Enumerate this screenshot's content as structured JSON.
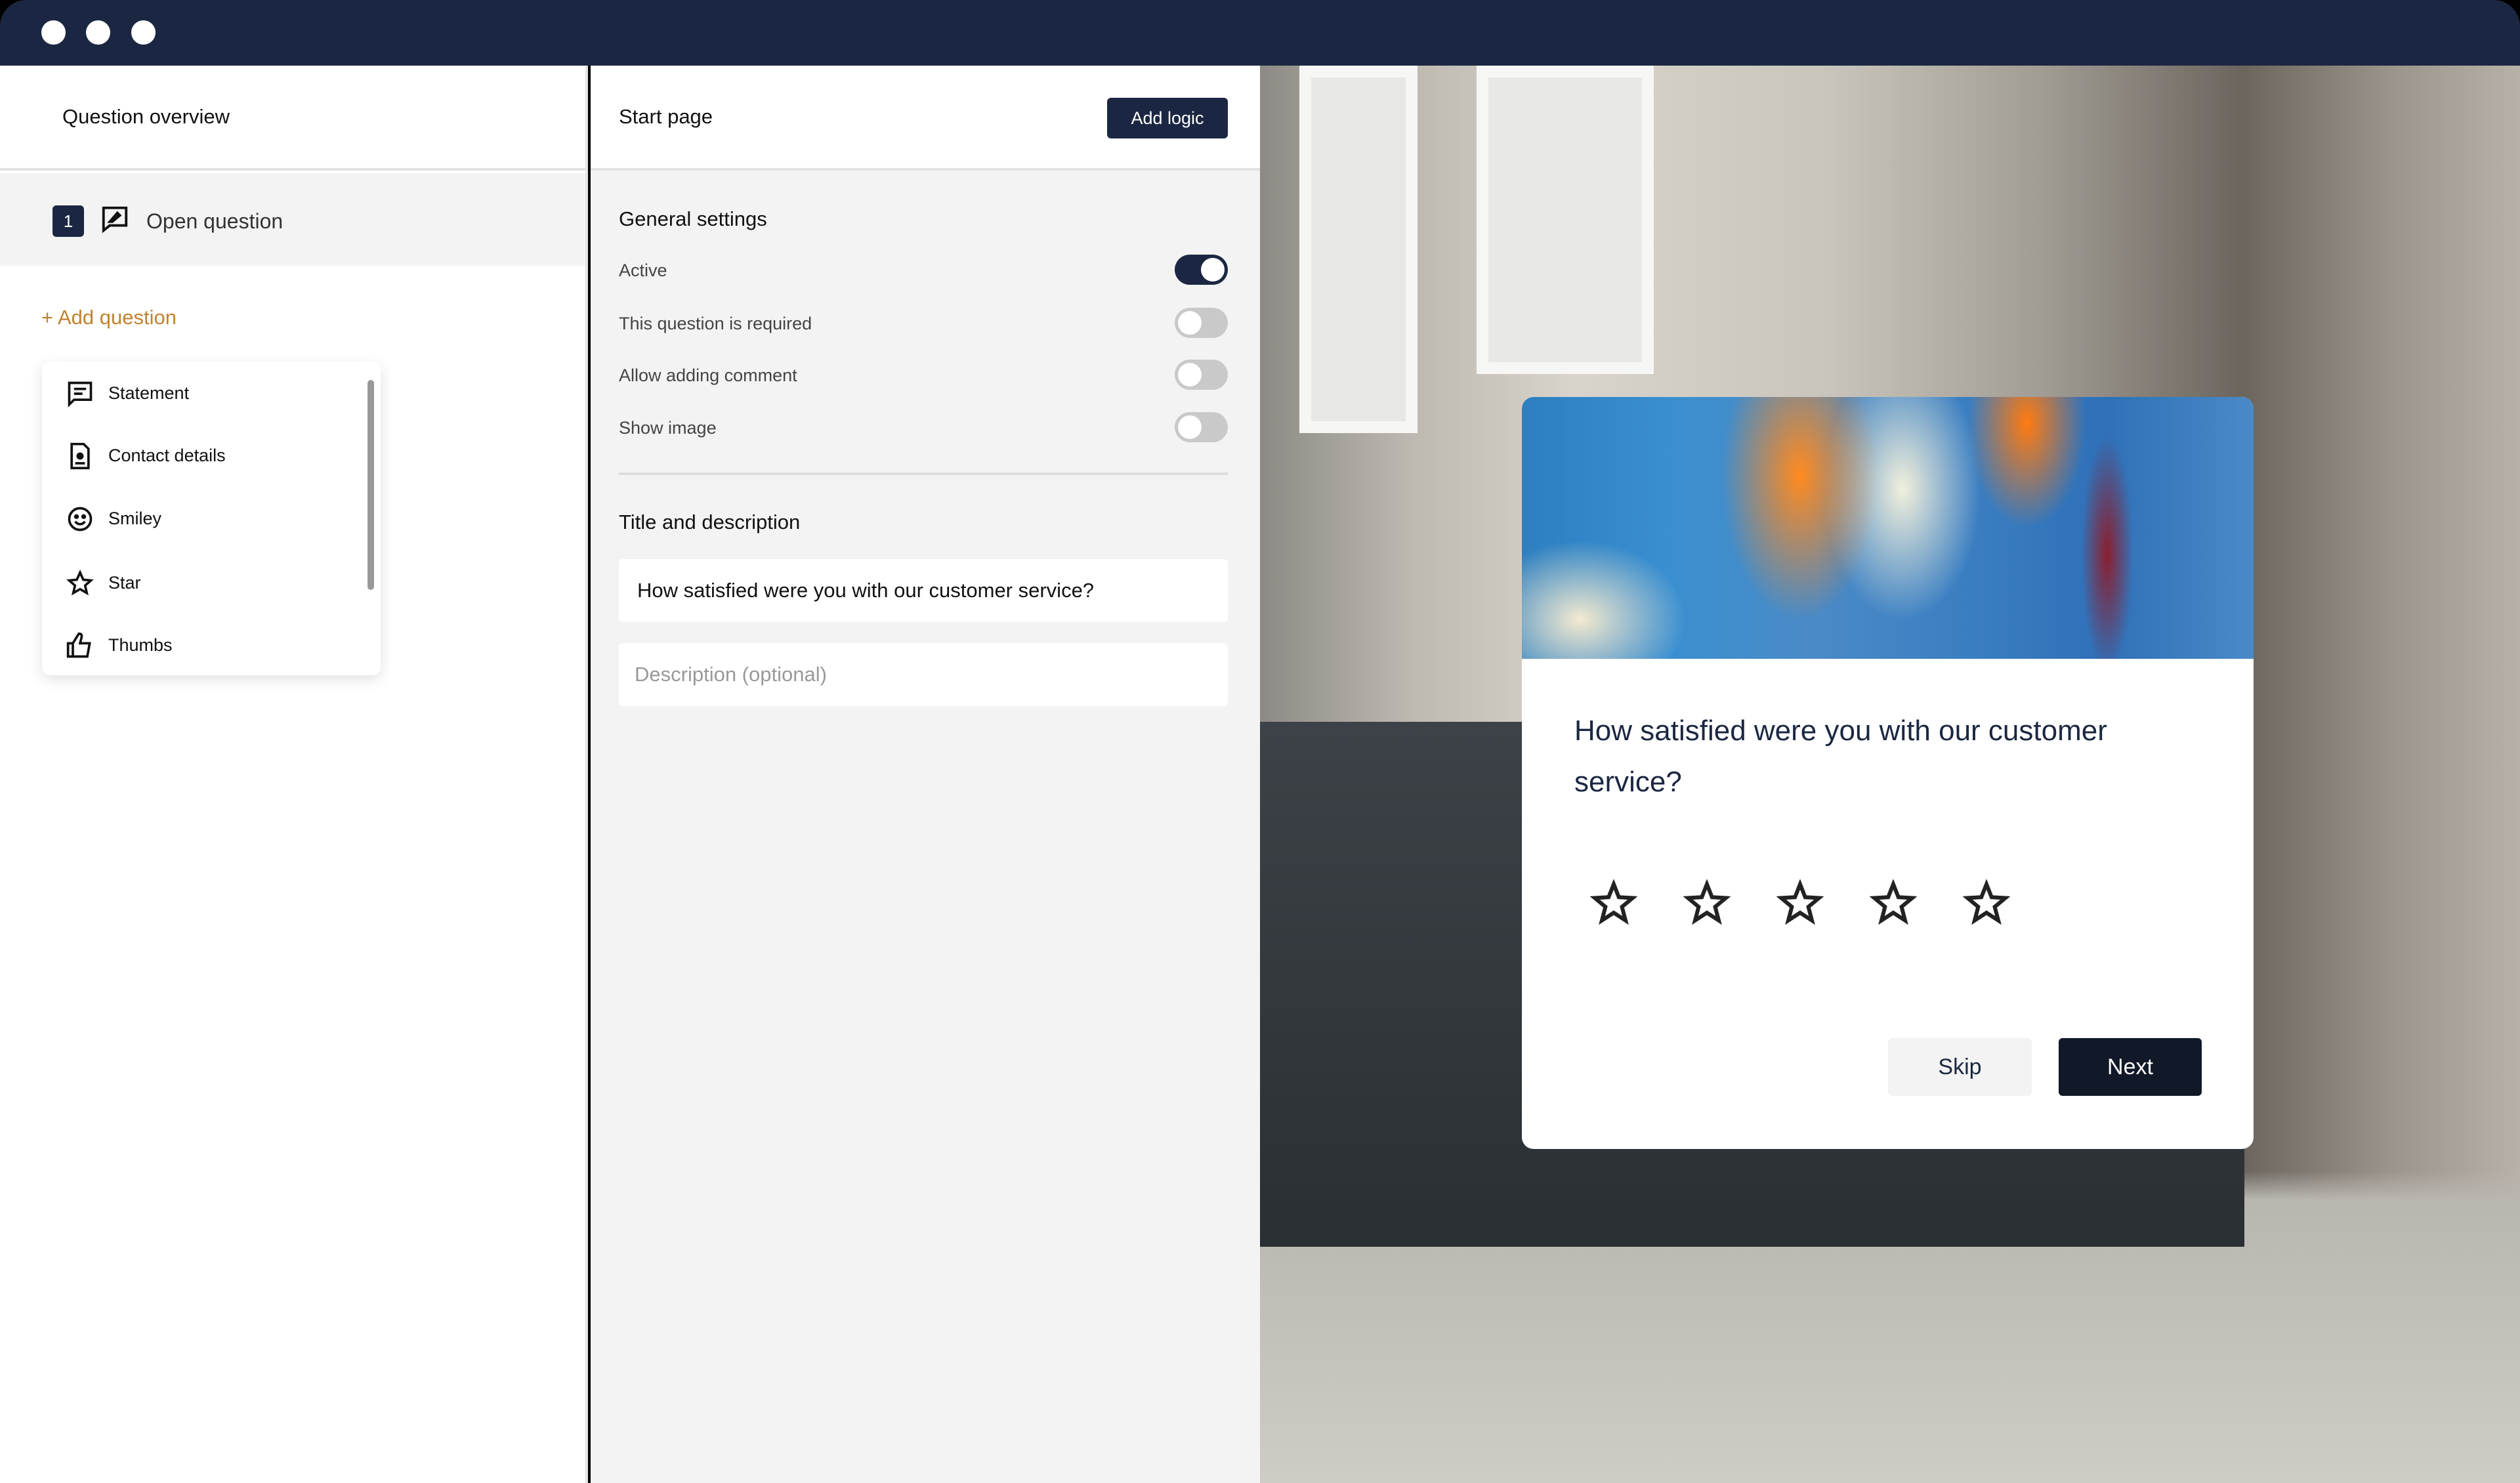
{
  "left_panel": {
    "title": "Question overview",
    "questions": [
      {
        "number": "1",
        "icon": "open-question-icon",
        "label": "Open question"
      }
    ],
    "add_question": "+ Add question",
    "question_types": [
      {
        "icon": "statement-icon",
        "label": "Statement"
      },
      {
        "icon": "contact-card-icon",
        "label": "Contact details"
      },
      {
        "icon": "smiley-icon",
        "label": "Smiley"
      },
      {
        "icon": "star-icon",
        "label": "Star"
      },
      {
        "icon": "thumbs-up-icon",
        "label": "Thumbs"
      }
    ]
  },
  "middle_panel": {
    "title": "Start page",
    "add_logic": "Add logic",
    "general_settings": "General settings",
    "settings": [
      {
        "label": "Active",
        "on": true
      },
      {
        "label": "This question is required",
        "on": false
      },
      {
        "label": "Allow adding comment",
        "on": false
      },
      {
        "label": "Show image",
        "on": false
      }
    ],
    "title_and_description": "Title and description",
    "title_value": "How satisfied were you with our customer service?",
    "description_placeholder": "Description (optional)"
  },
  "preview": {
    "question": "How satisfied were you with our customer service?",
    "star_count": 5,
    "skip": "Skip",
    "next": "Next"
  },
  "colors": {
    "navy": "#1b2742",
    "accent": "#c0832e",
    "panel": "#f3f3f3"
  }
}
